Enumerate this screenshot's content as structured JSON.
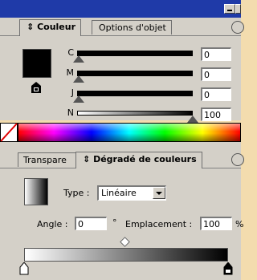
{
  "palette": {
    "title_bg": "#1f3aa8",
    "panel_bg": "#d4d0c8",
    "page_bg": "#f3dcae"
  },
  "color_panel": {
    "tabs": [
      {
        "label": "Couleur",
        "active": true,
        "marker": "⇕"
      },
      {
        "label": "Options d'objet",
        "active": false
      }
    ],
    "channels": [
      {
        "label": "C",
        "value": "0",
        "level_pct": 0
      },
      {
        "label": "M",
        "value": "0",
        "level_pct": 0
      },
      {
        "label": "J",
        "value": "0",
        "level_pct": 0
      },
      {
        "label": "N",
        "value": "100",
        "level_pct": 100
      }
    ],
    "fill_color": "#000000",
    "icons": [
      "panel-menu-icon",
      "out-of-gamut-icon",
      "none-swatch-icon",
      "spectrum-bar"
    ]
  },
  "gradient_panel": {
    "tabs": [
      {
        "label": "Transpare",
        "active": false
      },
      {
        "label": "Dégradé de couleurs",
        "active": true,
        "marker": "⇕"
      }
    ],
    "type_label": "Type :",
    "type_value": "Linéaire",
    "angle_label": "Angle :",
    "angle_value": "0",
    "degree_symbol": "°",
    "location_label": "Emplacement :",
    "location_value": "100",
    "percent_symbol": "%",
    "gradient_from": "#ffffff",
    "gradient_to": "#000000",
    "midpoint_pct": 50
  }
}
